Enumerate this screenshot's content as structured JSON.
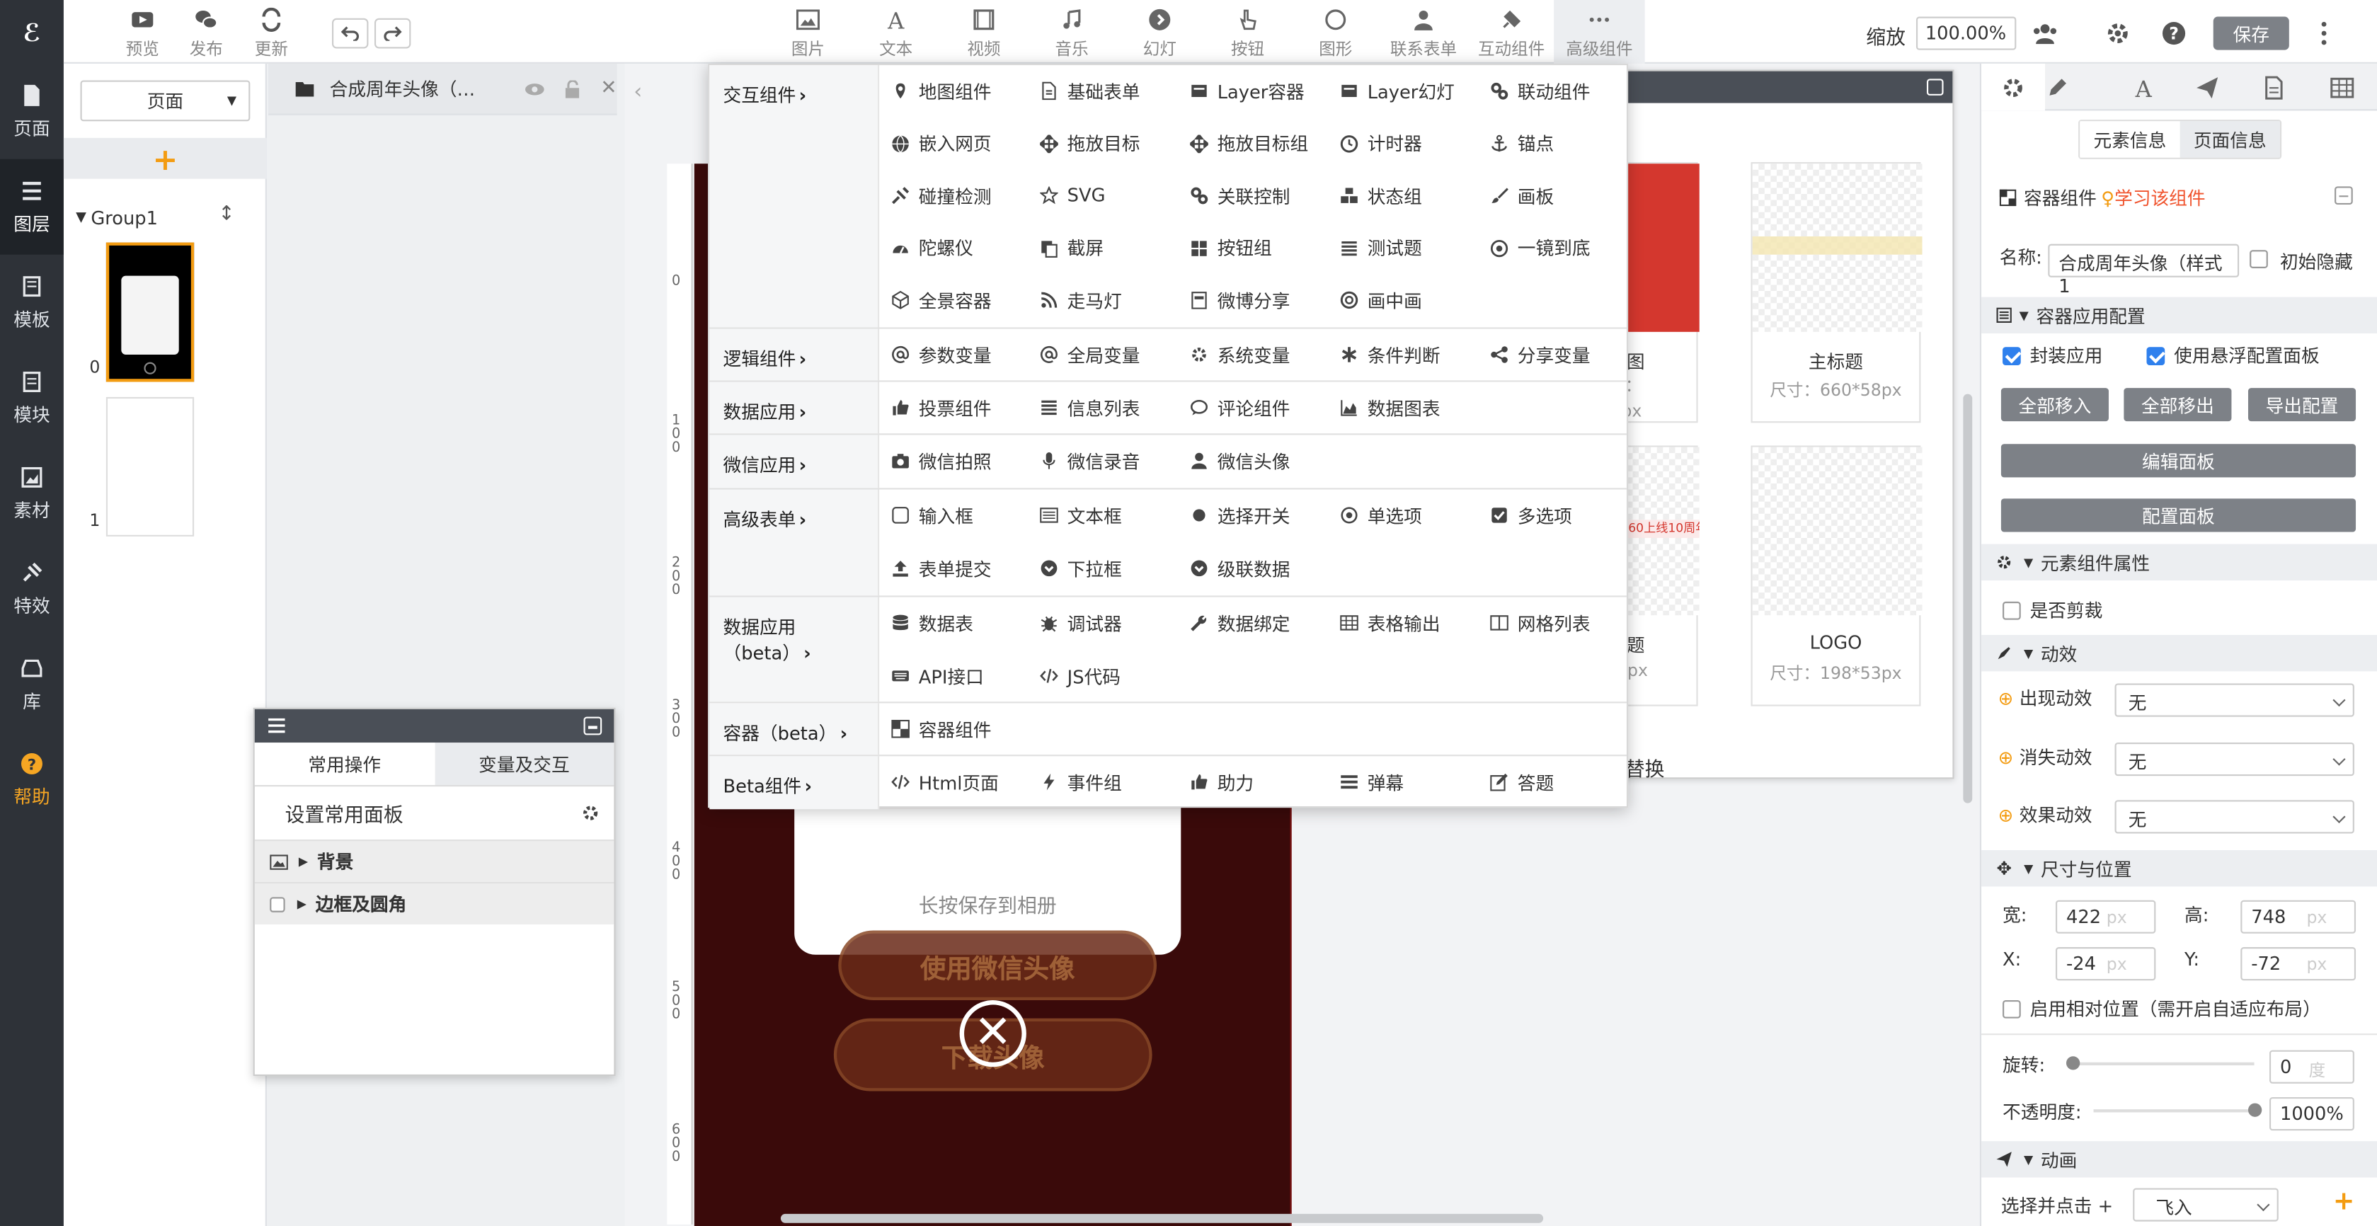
{
  "leftnav": {
    "logo": "ℰ",
    "items": [
      {
        "label": "页面",
        "icon": "page-icon"
      },
      {
        "label": "图层",
        "icon": "layers-icon"
      },
      {
        "label": "模板",
        "icon": "template-icon"
      },
      {
        "label": "模块",
        "icon": "module-icon"
      },
      {
        "label": "素材",
        "icon": "material-icon"
      },
      {
        "label": "特效",
        "icon": "effects-icon"
      },
      {
        "label": "库",
        "icon": "library-icon"
      },
      {
        "label": "帮助",
        "icon": "help-icon"
      }
    ]
  },
  "toolbar": {
    "left": [
      {
        "label": "预览",
        "icon": "preview-icon"
      },
      {
        "label": "发布",
        "icon": "wechat-icon"
      },
      {
        "label": "更新",
        "icon": "refresh-icon"
      }
    ],
    "center": [
      {
        "label": "图片",
        "icon": "image-icon"
      },
      {
        "label": "文本",
        "icon": "text-icon"
      },
      {
        "label": "视频",
        "icon": "video-icon"
      },
      {
        "label": "音乐",
        "icon": "music-icon"
      },
      {
        "label": "幻灯",
        "icon": "slideshow-icon"
      },
      {
        "label": "按钮",
        "icon": "pointer-icon"
      },
      {
        "label": "图形",
        "icon": "shape-icon"
      },
      {
        "label": "联系表单",
        "icon": "contact-form-icon"
      },
      {
        "label": "互动组件",
        "icon": "plugin-icon"
      },
      {
        "label": "高级组件",
        "icon": "more-icon"
      }
    ],
    "zoom_label": "缩放",
    "zoom_value": "100.00%",
    "save_label": "保存"
  },
  "pagepanel": {
    "page_select": "页面",
    "group_label": "Group1",
    "thumb_nums": [
      "0",
      "1"
    ]
  },
  "layer": {
    "title": "合成周年头像（…"
  },
  "canvas": {
    "ruler_ticks": [
      "0",
      "1\n0\n0",
      "2\n0\n0",
      "3\n0\n0",
      "4\n0\n0",
      "5\n0\n0",
      "6\n0\n0"
    ],
    "poster_text": "长按保存到相册",
    "btn1": "使用微信头像",
    "btn2": "下载头像",
    "close_symbol": "✕"
  },
  "bgpanel": {
    "cards": [
      {
        "title": "背景图",
        "size": "尺寸：\n*1496px"
      },
      {
        "title": "主标题",
        "size": "尺寸：660*58px"
      },
      {
        "title": "副标题",
        "size": "500*63px"
      },
      {
        "title": "LOGO",
        "size": "尺寸：198*53px"
      }
    ],
    "banner_text": "360上线10周年",
    "footer_text": "替换"
  },
  "commonpanel": {
    "tabs": [
      "常用操作",
      "变量及交互"
    ],
    "setting_label": "设置常用面板",
    "rows": [
      "背景",
      "边框及圆角"
    ]
  },
  "menu": {
    "sections": [
      {
        "category": "交互组件",
        "items": [
          {
            "label": "地图组件",
            "icon": "map-marker-icon"
          },
          {
            "label": "基础表单",
            "icon": "file-icon"
          },
          {
            "label": "Layer容器",
            "icon": "layer-box-icon"
          },
          {
            "label": "Layer幻灯",
            "icon": "layer-slide-icon"
          },
          {
            "label": "联动组件",
            "icon": "gears-icon"
          },
          {
            "label": "嵌入网页",
            "icon": "globe-icon"
          },
          {
            "label": "拖放目标",
            "icon": "move-icon"
          },
          {
            "label": "拖放目标组",
            "icon": "move-icon"
          },
          {
            "label": "计时器",
            "icon": "timer-icon"
          },
          {
            "label": "锚点",
            "icon": "anchor-icon"
          },
          {
            "label": "碰撞检测",
            "icon": "collision-icon"
          },
          {
            "label": "SVG",
            "icon": "star-icon"
          },
          {
            "label": "关联控制",
            "icon": "gears-icon"
          },
          {
            "label": "状态组",
            "icon": "cubes-icon"
          },
          {
            "label": "画板",
            "icon": "brush-icon"
          },
          {
            "label": "陀螺仪",
            "icon": "gyroscope-icon"
          },
          {
            "label": "截屏",
            "icon": "copy-icon"
          },
          {
            "label": "按钮组",
            "icon": "grid-icon"
          },
          {
            "label": "测试题",
            "icon": "list-icon"
          },
          {
            "label": "一镜到底",
            "icon": "target-icon"
          },
          {
            "label": "全景容器",
            "icon": "panorama-icon"
          },
          {
            "label": "走马灯",
            "icon": "rss-icon"
          },
          {
            "label": "微博分享",
            "icon": "weibo-icon"
          },
          {
            "label": "画中画",
            "icon": "lifebuoy-icon"
          }
        ]
      },
      {
        "category": "逻辑组件",
        "items": [
          {
            "label": "参数变量",
            "icon": "at-icon"
          },
          {
            "label": "全局变量",
            "icon": "at-icon"
          },
          {
            "label": "系统变量",
            "icon": "gear-icon"
          },
          {
            "label": "条件判断",
            "icon": "asterisk-icon"
          },
          {
            "label": "分享变量",
            "icon": "share-icon"
          }
        ]
      },
      {
        "category": "数据应用",
        "items": [
          {
            "label": "投票组件",
            "icon": "thumbs-up-icon"
          },
          {
            "label": "信息列表",
            "icon": "list-icon"
          },
          {
            "label": "评论组件",
            "icon": "comment-icon"
          },
          {
            "label": "数据图表",
            "icon": "area-chart-icon"
          }
        ]
      },
      {
        "category": "微信应用",
        "items": [
          {
            "label": "微信拍照",
            "icon": "camera-icon"
          },
          {
            "label": "微信录音",
            "icon": "microphone-icon"
          },
          {
            "label": "微信头像",
            "icon": "user-icon"
          }
        ]
      },
      {
        "category": "高级表单",
        "items": [
          {
            "label": "输入框",
            "icon": "input-icon"
          },
          {
            "label": "文本框",
            "icon": "textarea-icon"
          },
          {
            "label": "选择开关",
            "icon": "pointer-icon"
          },
          {
            "label": "单选项",
            "icon": "radio-icon"
          },
          {
            "label": "多选项",
            "icon": "checkbox-icon"
          },
          {
            "label": "表单提交",
            "icon": "upload-icon"
          },
          {
            "label": "下拉框",
            "icon": "chevron-circle-icon"
          },
          {
            "label": "级联数据",
            "icon": "chevron-circle-icon"
          }
        ]
      },
      {
        "category": "数据应用（beta）",
        "items": [
          {
            "label": "数据表",
            "icon": "database-icon"
          },
          {
            "label": "调试器",
            "icon": "bug-icon"
          },
          {
            "label": "数据绑定",
            "icon": "wrench-icon"
          },
          {
            "label": "表格输出",
            "icon": "table-icon"
          },
          {
            "label": "网格列表",
            "icon": "columns-icon"
          },
          {
            "label": "API接口",
            "icon": "keyboard-icon"
          },
          {
            "label": "JS代码",
            "icon": "code-icon"
          }
        ]
      },
      {
        "category": "容器（beta）",
        "items": [
          {
            "label": "容器组件",
            "icon": "container-icon"
          }
        ]
      },
      {
        "category": "Beta组件",
        "items": [
          {
            "label": "Html页面",
            "icon": "code-icon"
          },
          {
            "label": "事件组",
            "icon": "bolt-icon"
          },
          {
            "label": "助力",
            "icon": "thumbs-up-icon"
          },
          {
            "label": "弹幕",
            "icon": "bars-icon"
          },
          {
            "label": "答题",
            "icon": "edit-icon"
          }
        ]
      }
    ]
  },
  "rightpanel": {
    "info_tabs": [
      "元素信息",
      "页面信息"
    ],
    "component_title": "容器组件",
    "learn_link": "学习该组件",
    "name_label": "名称:",
    "name_value": "合成周年头像（样式1",
    "initial_hide": "初始隐藏",
    "container_config": "容器应用配置",
    "wrap_app": "封装应用",
    "use_float_panel": "使用悬浮配置面板",
    "btn_move_in": "全部移入",
    "btn_move_out": "全部移出",
    "btn_export": "导出配置",
    "btn_edit_panel": "编辑面板",
    "btn_config_panel": "配置面板",
    "element_props": "元素组件属性",
    "clip": "是否剪裁",
    "anim_effects": "动效",
    "appear_label": "出现动效",
    "disappear_label": "消失动效",
    "effect_label": "效果动效",
    "none": "无",
    "size_pos": "尺寸与位置",
    "w_label": "宽:",
    "w_value": "422",
    "h_label": "高:",
    "h_value": "748",
    "x_label": "X:",
    "x_value": "-24",
    "y_label": "Y:",
    "y_value": "-72",
    "px": "px",
    "relative_pos": "启用相对位置（需开启自适应布局）",
    "rotate_label": "旋转:",
    "rotate_value": "0",
    "deg": "度",
    "opacity_label": "不透明度:",
    "opacity_value": "1000%",
    "animation": "动画",
    "select_click": "选择并点击 +",
    "fly_in": "飞入"
  }
}
